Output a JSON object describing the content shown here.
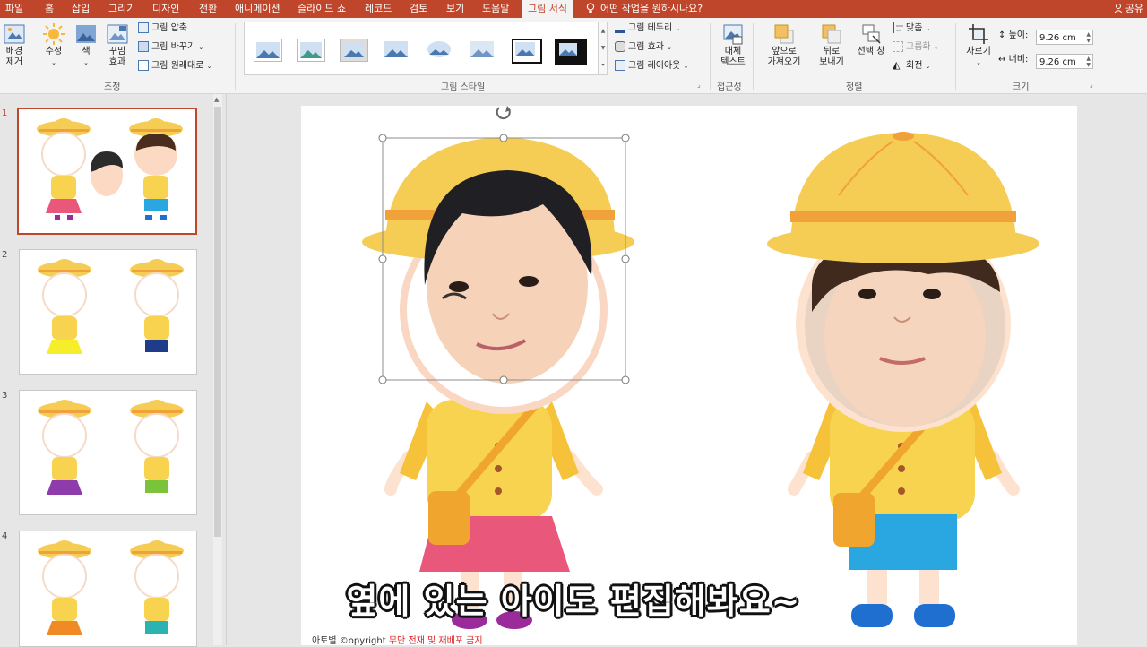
{
  "tabs": [
    "파일",
    "홈",
    "삽입",
    "그리기",
    "디자인",
    "전환",
    "애니메이션",
    "슬라이드 쇼",
    "레코드",
    "검토",
    "보기",
    "도움말",
    "그림 서식"
  ],
  "active_tab_index": 12,
  "tell_me": "어떤 작업을 원하시나요?",
  "share": "공유",
  "ribbon": {
    "adjust": {
      "remove_bg": "배경\n제거",
      "corrections": "수정",
      "color": "색",
      "artistic": "꾸밈\n효과",
      "compress": "그림 압축",
      "change": "그림 바꾸기",
      "reset": "그림 원래대로",
      "group_label": "조정"
    },
    "styles": {
      "group_label": "그림 스타일",
      "border": "그림 테두리",
      "effects": "그림 효과",
      "layout": "그림 레이아웃"
    },
    "accessibility": {
      "alt_text": "대체\n텍스트",
      "group_label": "접근성"
    },
    "arrange": {
      "bring_forward": "앞으로\n가져오기",
      "send_backward": "뒤로\n보내기",
      "selection_pane": "선택 창",
      "align": "맞춤",
      "group": "그룹화",
      "rotate": "회전",
      "group_label": "정렬"
    },
    "size": {
      "crop": "자르기",
      "height_label": "높이:",
      "height_value": "9.26 cm",
      "width_label": "너비:",
      "width_value": "9.26 cm",
      "group_label": "크기"
    }
  },
  "slides": [
    {
      "number": "1",
      "selected": true
    },
    {
      "number": "2",
      "selected": false
    },
    {
      "number": "3",
      "selected": false
    },
    {
      "number": "4",
      "selected": false
    }
  ],
  "caption": "옆에 있는 아이도 편집해봐요~",
  "copyright": {
    "part1": "아토별 ©opyright",
    "part2": "무단 전재 및 재배포 금지"
  },
  "colors": {
    "accent": "#c0462b",
    "hat": "#f5cd55",
    "band": "#f0a13a",
    "shirt": "#f7d34f",
    "bag": "#f0a62e",
    "skirt": "#e9577a",
    "shorts": "#2aa6e0",
    "shoes": "#1f6fd0",
    "skin": "#fde3cf"
  }
}
